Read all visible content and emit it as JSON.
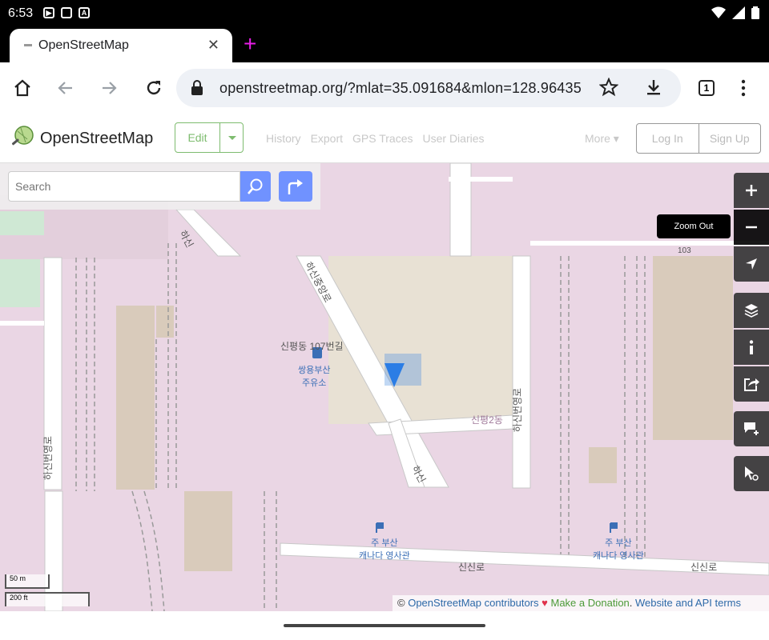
{
  "status_bar": {
    "time": "6:53",
    "notif_icons": [
      "play-icon",
      "sim-icon",
      "a-icon"
    ],
    "right_icons": [
      "wifi-icon",
      "signal-icon",
      "battery-icon"
    ]
  },
  "browser": {
    "tab": {
      "title": "OpenStreetMap",
      "close_icon": "close-icon"
    },
    "new_tab_icon": "plus-icon",
    "url": "openstreetmap.org/?mlat=35.091684&mlon=128.96435",
    "tab_count": "1"
  },
  "osm": {
    "brand": "OpenStreetMap",
    "edit_label": "Edit",
    "nav_links": [
      "History",
      "Export",
      "GPS Traces",
      "User Diaries"
    ],
    "more_label": "More",
    "login_label": "Log In",
    "signup_label": "Sign Up",
    "search_placeholder": "Search",
    "zoom_tooltip": "Zoom Out",
    "attribution": {
      "copyright": "©",
      "contributors": "OpenStreetMap contributors",
      "donation": "Make a Donation",
      "terms": "Website and API terms"
    },
    "scale": {
      "top": "50 m",
      "bottom": "200 ft"
    }
  },
  "map": {
    "labels": {
      "road_top": "하신중앙로",
      "road_left": "하신",
      "road_vertical_left": "하신번영로",
      "road_vertical_right": "하신번영로",
      "road_bottom_right": "신신로",
      "road_bottom_mid": "신신로",
      "addr": "신평2동",
      "street_small": "신평동 107번길",
      "road_diag_bottom": "하신",
      "num_103": "103"
    },
    "pois": [
      {
        "name": "쌍용부산",
        "sub": "주유소"
      },
      {
        "name": "주 부산",
        "sub": "캐나다 영사관"
      },
      {
        "name": "주 부산",
        "sub": "캐나다 영사관"
      }
    ],
    "marker_color": "#1a73e8"
  }
}
